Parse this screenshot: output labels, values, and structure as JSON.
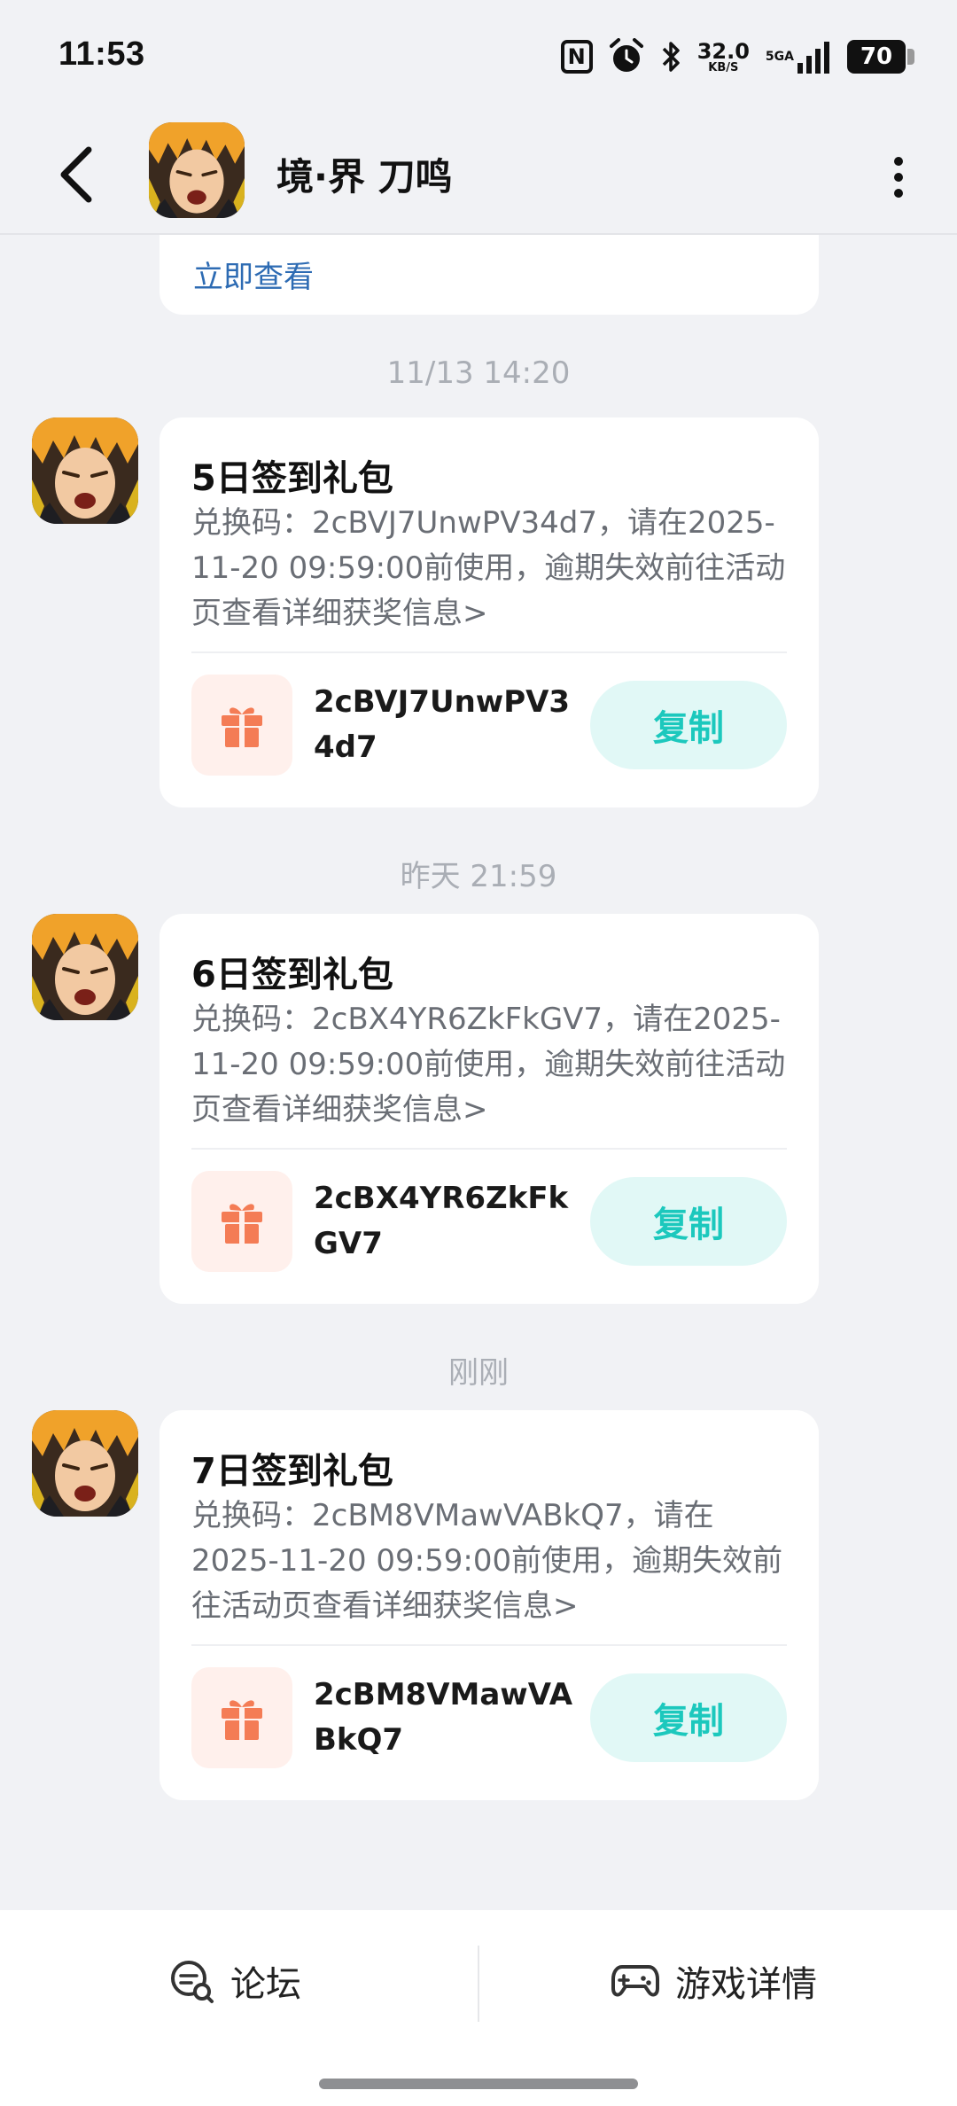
{
  "status_bar": {
    "time": "11:53",
    "nfc_label": "N",
    "speed_value": "32.0",
    "speed_unit": "KB/S",
    "network_type": "5GA",
    "battery": "70"
  },
  "header": {
    "title": "境·界 刀鸣",
    "back_icon": "chevron-left-icon",
    "more_icon": "more-vertical-icon"
  },
  "feed": {
    "previous_link": "立即查看",
    "messages": [
      {
        "timestamp": "11/13  14:20",
        "title": "5日签到礼包",
        "body": "兑换码：2cBVJ7UnwPV34d7，请在2025-11-20 09:59:00前使用，逾期失效前往活动页查看详细获奖信息>",
        "code": "2cBVJ7UnwPV34d7",
        "copy_label": "复制"
      },
      {
        "timestamp": "昨天  21:59",
        "title": "6日签到礼包",
        "body": "兑换码：2cBX4YR6ZkFkGV7，请在2025-11-20 09:59:00前使用，逾期失效前往活动页查看详细获奖信息>",
        "code": "2cBX4YR6ZkFkGV7",
        "copy_label": "复制"
      },
      {
        "timestamp": "刚刚",
        "title": "7日签到礼包",
        "body": "兑换码：2cBM8VMawVABkQ7，请在2025-11-20 09:59:00前使用，逾期失效前往活动页查看详细获奖信息>",
        "code": "2cBM8VMawVABkQ7",
        "copy_label": "复制"
      }
    ]
  },
  "bottom_bar": {
    "forum_label": "论坛",
    "forum_icon": "forum-chat-icon",
    "game_details_label": "游戏详情",
    "game_icon": "gamepad-icon"
  },
  "colors": {
    "background": "#f1f2f5",
    "link": "#2d6bb3",
    "gift_accent": "#f47c55",
    "copy_button_bg": "#e1f8f6",
    "copy_button_text": "#1cc8bd",
    "timestamp": "#aaaeb5"
  }
}
